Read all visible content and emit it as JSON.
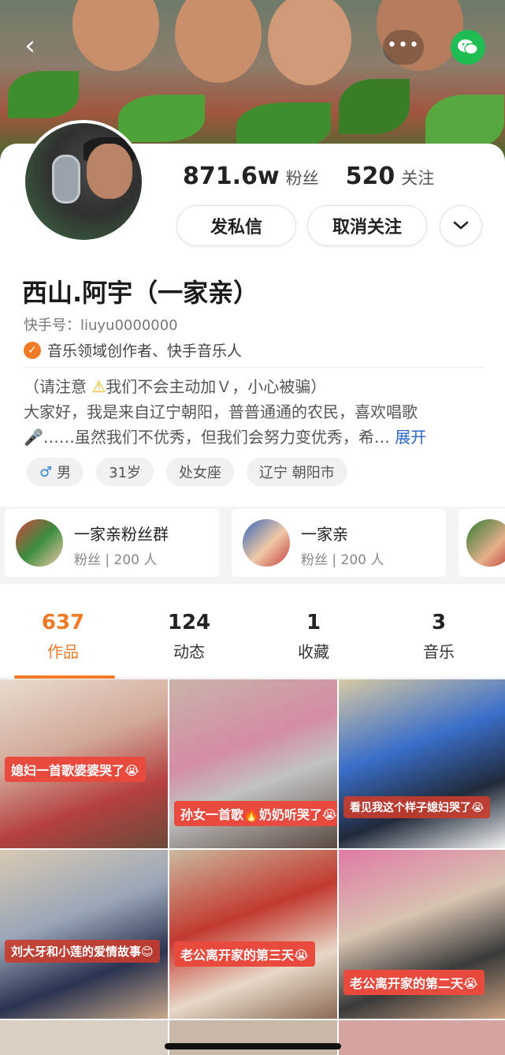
{
  "header": {
    "back_icon": "chevron-left-icon",
    "more_icon": "more-dots-icon",
    "share_icon": "wechat-icon"
  },
  "profile": {
    "followers_num": "871.6w",
    "followers_label": "粉丝",
    "following_num": "520",
    "following_label": "关注",
    "message_button": "发私信",
    "unfollow_button": "取消关注",
    "name": "西山.阿宇（一家亲）",
    "kuaishou_id": "快手号：liuyu0000000",
    "cert_text": "音乐领域创作者、快手音乐人",
    "bio_line1_a": "（请注意 ",
    "bio_line1_b": "⚠",
    "bio_line1_c": "我们不会主动加Ｖ，小心被骗）",
    "bio_line2": "大家好，我是来自辽宁朝阳，普普通通的农民，喜欢唱歌",
    "bio_line3": "🎤……虽然我们不优秀，但我们会努力变优秀，希…",
    "expand": "展开",
    "tags": [
      "男",
      "31岁",
      "处女座",
      "辽宁 朝阳市"
    ],
    "male_symbol": "♂"
  },
  "groups": [
    {
      "name": "一家亲粉丝群",
      "sub": "粉丝 | 200 人"
    },
    {
      "name": "一家亲",
      "sub": "粉丝 | 200 人"
    }
  ],
  "tabs": [
    {
      "num": "637",
      "label": "作品"
    },
    {
      "num": "124",
      "label": "动态"
    },
    {
      "num": "1",
      "label": "收藏"
    },
    {
      "num": "3",
      "label": "音乐"
    }
  ],
  "videos": [
    "媳妇一首歌婆婆哭了😭",
    "孙女一首歌🔥奶奶听哭了😭",
    "看见我这个样子媳妇哭了😭",
    "刘大牙和小莲的爱情故事😊",
    "老公离开家的第三天😭",
    "老公离开家的第二天😭"
  ]
}
